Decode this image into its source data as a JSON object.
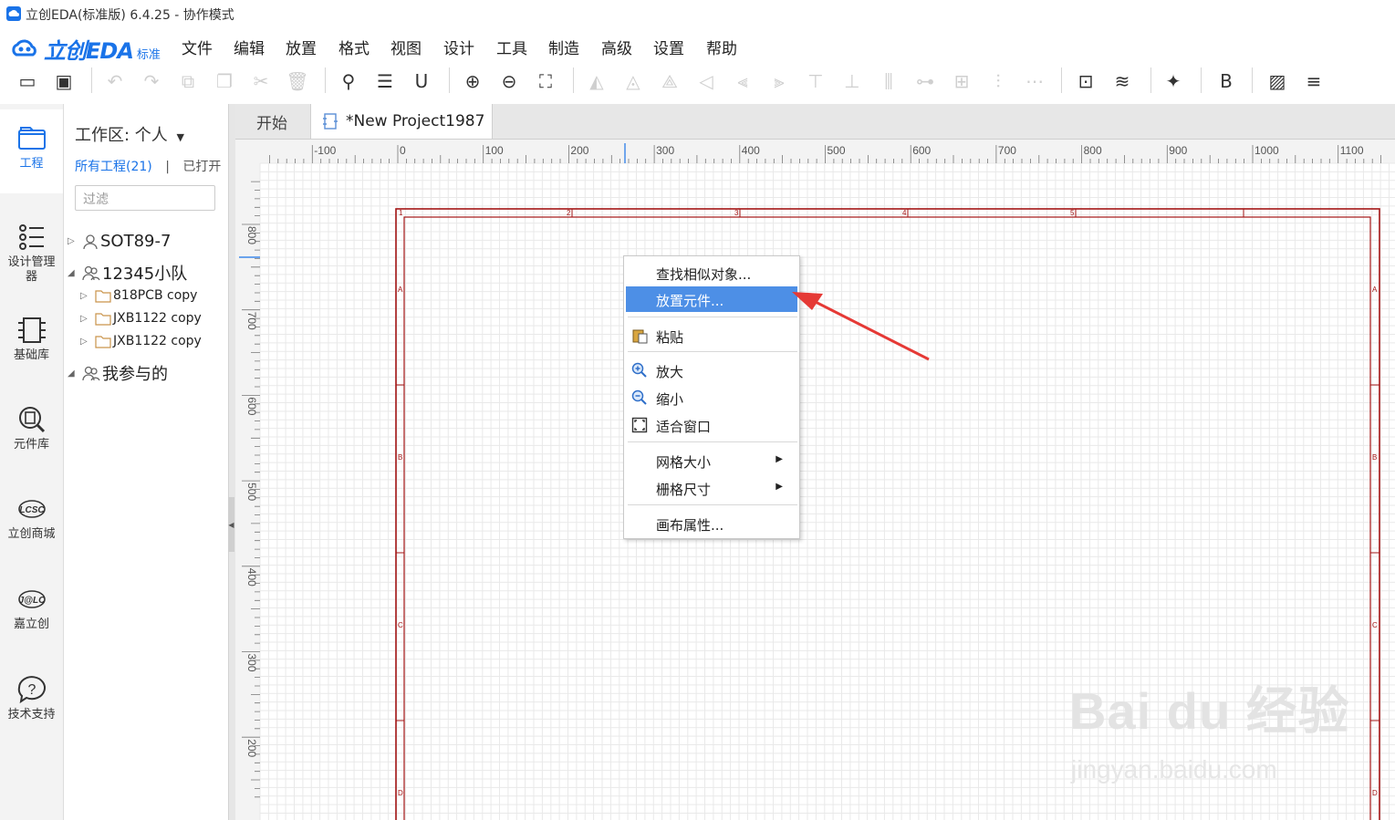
{
  "window": {
    "title": "立创EDA(标准版) 6.4.25 - 协作模式"
  },
  "logo": {
    "text": "立创EDA",
    "sub": "标准"
  },
  "menu": [
    "文件",
    "编辑",
    "放置",
    "格式",
    "视图",
    "设计",
    "工具",
    "制造",
    "高级",
    "设置",
    "帮助"
  ],
  "toolbar_icons": [
    "open-file-icon",
    "save-icon",
    "undo-icon",
    "redo-icon",
    "copy-icon",
    "duplicate-icon",
    "cut-icon",
    "delete-icon",
    "search-icon",
    "find-list-icon",
    "unit-icon",
    "zoom-in-icon",
    "zoom-out-icon",
    "fit-window-icon",
    "rotate-icon",
    "flip-icon",
    "mirror-icon",
    "align-icon",
    "align-left-icon",
    "align-right-icon",
    "align-top-icon",
    "align-bottom-icon",
    "align-hcenter-icon",
    "align-vcenter-icon",
    "distribute-icon",
    "distribute-v-icon",
    "distribute-h-icon",
    "simulate-icon",
    "layers-icon",
    "pin-icon",
    "bom-icon",
    "image-icon",
    "stack-icon"
  ],
  "rail": [
    {
      "label": "工程",
      "icon": "folder-icon"
    },
    {
      "label": "设计管理器",
      "icon": "design-manager-icon"
    },
    {
      "label": "基础库",
      "icon": "chip-icon"
    },
    {
      "label": "元件库",
      "icon": "component-search-icon"
    },
    {
      "label": "立创商城",
      "icon": "lcsc-icon"
    },
    {
      "label": "嘉立创",
      "icon": "jlc-icon"
    },
    {
      "label": "技术支持",
      "icon": "help-icon"
    }
  ],
  "panel": {
    "workspace_label": "工作区: 个人",
    "all_projects": "所有工程(21)",
    "divider": "|",
    "opened": "已打开",
    "filter_placeholder": "过滤",
    "tree": [
      {
        "label": "SOT89-7",
        "level": 1,
        "icon": "user-icon",
        "expanded": false
      },
      {
        "label": "12345小队",
        "level": 1,
        "icon": "team-icon",
        "expanded": true
      },
      {
        "label": "818PCB copy",
        "level": 2,
        "icon": "folder-icon"
      },
      {
        "label": "JXB1122 copy",
        "level": 2,
        "icon": "folder-icon"
      },
      {
        "label": "JXB1122 copy",
        "level": 2,
        "icon": "folder-icon"
      },
      {
        "label": "我参与的",
        "level": 1,
        "icon": "team-icon",
        "expanded": true
      }
    ]
  },
  "tabs": [
    {
      "label": "开始"
    },
    {
      "label": "*New Project1987",
      "active": true
    }
  ],
  "ruler": {
    "top_labels": [
      "-100",
      "0",
      "100",
      "200",
      "300",
      "400",
      "500",
      "600",
      "700",
      "800",
      "900",
      "1000",
      "1100"
    ],
    "left_labels": [
      "800",
      "700",
      "600",
      "500",
      "400",
      "300",
      "200"
    ]
  },
  "frame": {
    "col_labels": [
      "1",
      "2",
      "3",
      "4",
      "5"
    ],
    "row_labels": [
      "A",
      "B",
      "C",
      "D"
    ]
  },
  "context_menu": [
    {
      "label": "查找相似对象...",
      "icon": "",
      "submenu": false
    },
    {
      "label": "放置元件...",
      "icon": "",
      "submenu": false,
      "highlighted": true
    },
    {
      "separator": true
    },
    {
      "label": "粘贴",
      "icon": "paste-icon",
      "submenu": false
    },
    {
      "separator": true
    },
    {
      "label": "放大",
      "icon": "zoom-in-icon",
      "submenu": false
    },
    {
      "label": "缩小",
      "icon": "zoom-out-icon",
      "submenu": false
    },
    {
      "label": "适合窗口",
      "icon": "fit-window-icon",
      "submenu": false
    },
    {
      "separator": true
    },
    {
      "label": "网格大小",
      "icon": "",
      "submenu": true
    },
    {
      "label": "栅格尺寸",
      "icon": "",
      "submenu": true
    },
    {
      "separator": true
    },
    {
      "label": "画布属性...",
      "icon": "",
      "submenu": false
    }
  ],
  "watermark": {
    "main": "Bai du 经验",
    "sub": "jingyan.baidu.com"
  },
  "colors": {
    "accent": "#1a73e8",
    "frame": "#a31515",
    "highlight": "#4d8fe6",
    "arrow": "#e53935"
  }
}
